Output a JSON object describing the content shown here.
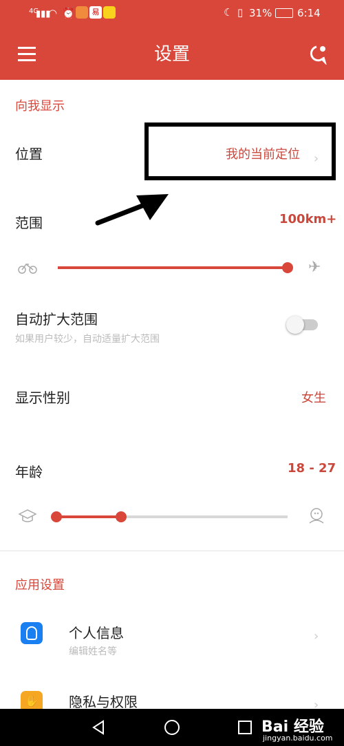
{
  "status_bar": {
    "network": "4G",
    "battery": "31%",
    "time": "6:14",
    "app_badge": "易"
  },
  "header": {
    "title": "设置"
  },
  "sections": {
    "show_me": "向我显示",
    "app_settings": "应用设置"
  },
  "location": {
    "label": "位置",
    "value": "我的当前定位"
  },
  "range": {
    "label": "范围",
    "value": "100km+",
    "level": 1.0
  },
  "auto_expand": {
    "label": "自动扩大范围",
    "description": "如果用户较少，自动适量扩大范围",
    "on": false
  },
  "gender": {
    "label": "显示性别",
    "value": "女生"
  },
  "age": {
    "label": "年龄",
    "value": "18 - 27",
    "min": 18,
    "max": 27
  },
  "profile": {
    "label": "个人信息",
    "sub": "编辑姓名等"
  },
  "privacy": {
    "label": "隐私与权限"
  },
  "watermark": {
    "text": "Bai 经验",
    "sub": "jingyan.baidu.com"
  },
  "colors": {
    "accent": "#d9463a",
    "blue": "#1a7ff0",
    "orange": "#f5a623"
  }
}
